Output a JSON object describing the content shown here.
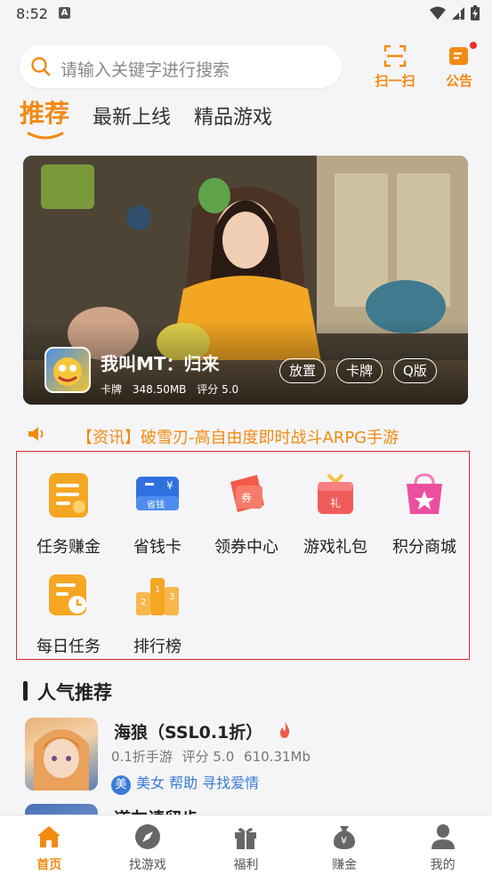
{
  "status": {
    "time": "8:52",
    "a_glyph": "A"
  },
  "search": {
    "placeholder": "请输入关键字进行搜索"
  },
  "actions": {
    "scan": "扫一扫",
    "notice": "公告"
  },
  "tabs": [
    {
      "label": "推荐",
      "active": true
    },
    {
      "label": "最新上线",
      "active": false
    },
    {
      "label": "精品游戏",
      "active": false
    }
  ],
  "banner": {
    "title": "我叫MT：归来",
    "type": "卡牌",
    "size": "348.50MB",
    "rating": "评分 5.0",
    "tags": [
      "放置",
      "卡牌",
      "Q版"
    ]
  },
  "news": {
    "text": "【资讯】破雪刃-高自由度即时战斗ARPG手游"
  },
  "features": [
    {
      "label": "任务赚金",
      "icon": "task-coin-icon"
    },
    {
      "label": "省钱卡",
      "icon": "savings-card-icon"
    },
    {
      "label": "领券中心",
      "icon": "coupon-icon"
    },
    {
      "label": "游戏礼包",
      "icon": "gift-pack-icon"
    },
    {
      "label": "积分商城",
      "icon": "points-mall-icon"
    },
    {
      "label": "每日任务",
      "icon": "daily-task-icon"
    },
    {
      "label": "排行榜",
      "icon": "ranking-icon"
    }
  ],
  "section": {
    "title": "人气推荐"
  },
  "games": [
    {
      "name": "海狼（SSL0.1折）",
      "meta": [
        "0.1折手游",
        "评分 5.0",
        "610.31Mb"
      ],
      "badge": "美",
      "tagline": "美女 帮助 寻找爱情"
    },
    {
      "name": "道友请留步"
    }
  ],
  "nav": [
    {
      "label": "首页",
      "icon": "home-icon",
      "active": true
    },
    {
      "label": "找游戏",
      "icon": "compass-icon",
      "active": false
    },
    {
      "label": "福利",
      "icon": "gift-icon",
      "active": false
    },
    {
      "label": "赚金",
      "icon": "money-bag-icon",
      "active": false
    },
    {
      "label": "我的",
      "icon": "user-icon",
      "active": false
    }
  ],
  "colors": {
    "accent": "#f28a12",
    "link": "#3a7bd5",
    "highlight_border": "#d32f2f"
  }
}
